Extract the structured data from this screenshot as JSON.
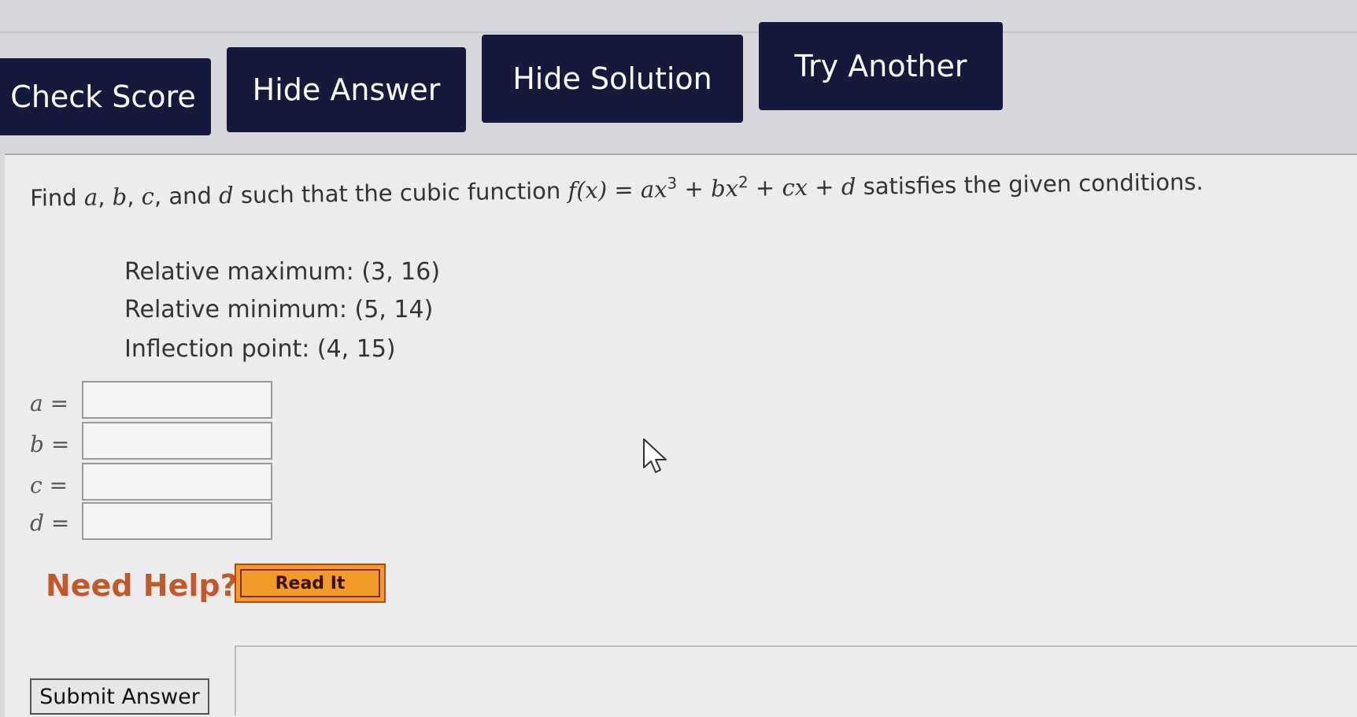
{
  "toolbar": {
    "check_score": "Check Score",
    "hide_answer": "Hide Answer",
    "hide_solution": "Hide Solution",
    "try_another": "Try Another"
  },
  "question": {
    "prefix": "Find ",
    "var_a": "a",
    "sep1": ", ",
    "var_b": "b",
    "sep2": ", ",
    "var_c": "c",
    "sep3": ", and ",
    "var_d": "d",
    "mid": " such that the cubic function ",
    "formula_fx": "f(x)",
    "formula_eq": " = ",
    "formula_ax": "ax",
    "exp3": "3",
    "plus1": " + ",
    "formula_bx": "bx",
    "exp2": "2",
    "plus2": " + ",
    "formula_cx": "cx",
    "plus3": " + ",
    "formula_d": "d",
    "suffix": " satisfies the given conditions."
  },
  "conditions": {
    "relative_max": "Relative maximum: (3, 16)",
    "relative_min": "Relative minimum: (5, 14)",
    "inflection": "Inflection point: (4, 15)"
  },
  "inputs": [
    {
      "label": "a =",
      "value": ""
    },
    {
      "label": "b =",
      "value": ""
    },
    {
      "label": "c =",
      "value": ""
    },
    {
      "label": "d =",
      "value": ""
    }
  ],
  "help": {
    "need_help": "Need Help?",
    "read_it": "Read It"
  },
  "submit": {
    "label": "Submit Answer"
  },
  "colors": {
    "button_dark": "#151a3d",
    "help_text": "#c05a2a",
    "read_it_bg": "#f29a2a"
  }
}
